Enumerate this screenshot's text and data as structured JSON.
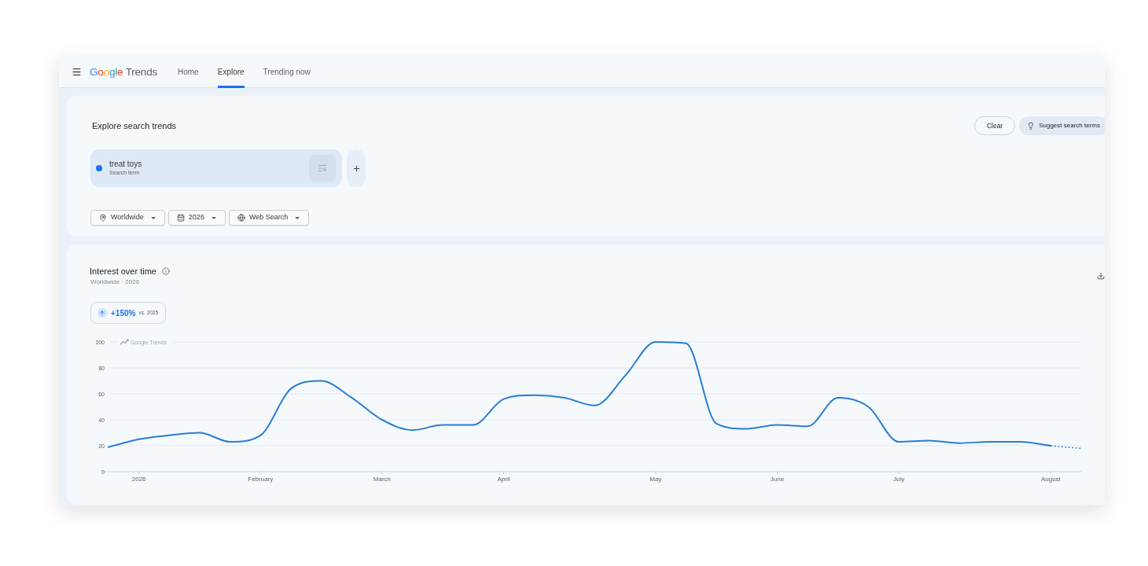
{
  "header": {
    "logo": {
      "brand": "Google",
      "product": "Trends"
    },
    "tabs": [
      {
        "label": "Home",
        "selected": false
      },
      {
        "label": "Explore",
        "selected": true
      },
      {
        "label": "Trending now",
        "selected": false
      }
    ]
  },
  "explore": {
    "title": "Explore search trends",
    "buttons": [
      {
        "label": "Clear",
        "kind": "outline"
      },
      {
        "label": "Suggest search terms",
        "kind": "tonal"
      }
    ],
    "terms": [
      {
        "term": "treat toys",
        "caption": "Search term",
        "color": "#1a73e8"
      }
    ],
    "filters": [
      {
        "label": "Worldwide",
        "kind": "location"
      },
      {
        "label": "2026",
        "kind": "date"
      },
      {
        "label": "Web Search",
        "kind": "property"
      }
    ]
  },
  "interest": {
    "title": "Interest over time",
    "subtitle": "Worldwide · 2026",
    "change": {
      "value": "+150%",
      "comparison": "vs. 2025",
      "increase": true
    },
    "chart_brand": "Google Trends",
    "last_point_partial": true,
    "chart_data": {
      "type": "line",
      "grid": true,
      "categories": [
        null,
        "2026",
        null,
        null,
        null,
        "February",
        null,
        null,
        null,
        "March",
        null,
        null,
        null,
        "April",
        null,
        null,
        null,
        null,
        "May",
        null,
        null,
        null,
        "June",
        null,
        null,
        null,
        "July",
        null,
        null,
        null,
        null,
        "August",
        null
      ],
      "series": [
        {
          "color": "#2b7cd3",
          "values": [
            19,
            25,
            28,
            30,
            23,
            28,
            64,
            70,
            57,
            40,
            32,
            36,
            36,
            56,
            59,
            57,
            51,
            74,
            100,
            99,
            37,
            33,
            36,
            35,
            57,
            50,
            23,
            24,
            22,
            23,
            23,
            20,
            18
          ]
        }
      ],
      "ylim": [
        0,
        100
      ],
      "yticks": [
        0,
        20,
        40,
        60,
        80,
        100
      ]
    }
  }
}
